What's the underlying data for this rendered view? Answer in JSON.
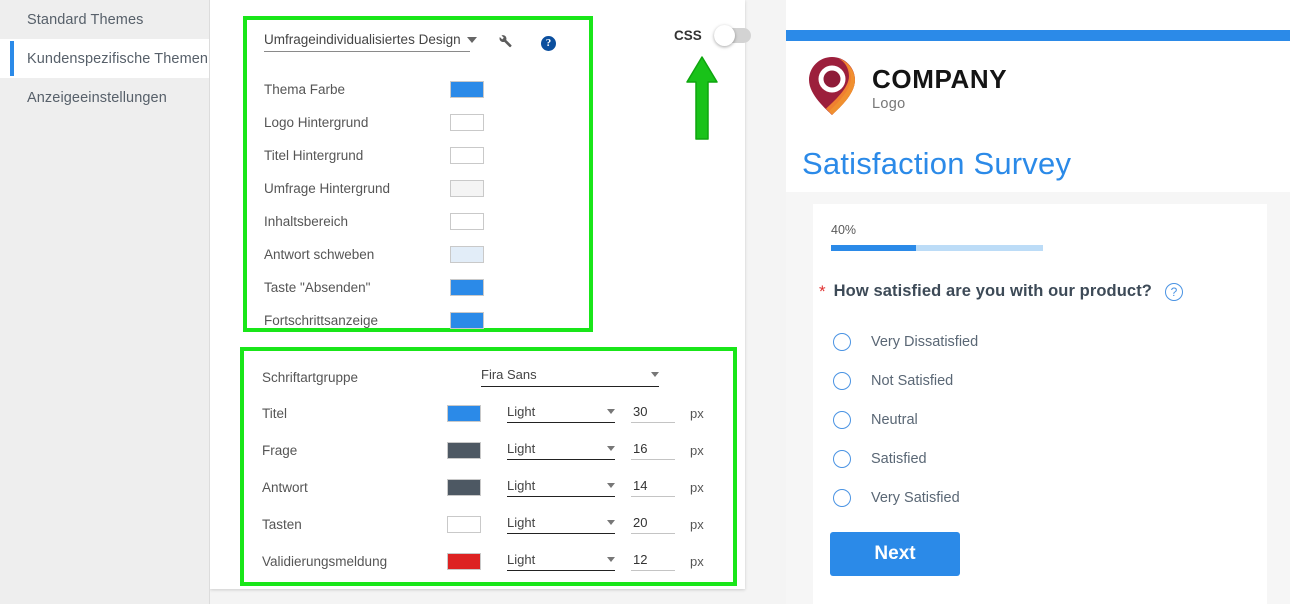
{
  "sidebar": {
    "items": [
      {
        "label": "Standard Themes",
        "active": false
      },
      {
        "label": "Kundenspezifische Themen",
        "active": true
      },
      {
        "label": "Anzeigeeinstellungen",
        "active": false
      }
    ]
  },
  "theme_panel": {
    "selected_theme": "Umfrageindividualisiertes Design",
    "wrench_icon": "wrench-icon",
    "help_icon": "help-icon",
    "help_glyph": "?",
    "color_rows": [
      {
        "label": "Thema Farbe",
        "color": "#2b8ae8"
      },
      {
        "label": "Logo Hintergrund",
        "color": "#ffffff"
      },
      {
        "label": "Titel Hintergrund",
        "color": "#ffffff"
      },
      {
        "label": "Umfrage Hintergrund",
        "color": "#f4f4f4"
      },
      {
        "label": "Inhaltsbereich",
        "color": "#ffffff"
      },
      {
        "label": "Antwort schweben",
        "color": "#e2edf8"
      },
      {
        "label": "Taste \"Absenden\"",
        "color": "#2b8ae8"
      },
      {
        "label": "Fortschrittsanzeige",
        "color": "#2b8ae8"
      }
    ]
  },
  "font_panel": {
    "group_label": "Schriftartgruppe",
    "group_value": "Fira Sans",
    "unit": "px",
    "rows": [
      {
        "label": "Titel",
        "color": "#2b8ae8",
        "weight": "Light",
        "size": "30"
      },
      {
        "label": "Frage",
        "color": "#4d5863",
        "weight": "Light",
        "size": "16"
      },
      {
        "label": "Antwort",
        "color": "#4d5863",
        "weight": "Light",
        "size": "14"
      },
      {
        "label": "Tasten",
        "color": "#ffffff",
        "weight": "Light",
        "size": "20"
      },
      {
        "label": "Validierungsmeldung",
        "color": "#dd2222",
        "weight": "Light",
        "size": "12"
      }
    ]
  },
  "css_toggle": {
    "label": "CSS",
    "enabled": false,
    "arrow_icon": "green-up-arrow-icon",
    "arrow_color": "#19c219"
  },
  "preview": {
    "topbar_color": "#2b8ae8",
    "logo": {
      "icon": "map-pin-logo-icon",
      "company": "COMPANY",
      "sub": "Logo"
    },
    "title": "Satisfaction Survey",
    "progress": {
      "percent_label": "40%",
      "percent": 40
    },
    "question": {
      "required_marker": "*",
      "text": "How satisfied are you with our product?",
      "help_icon": "question-help-icon",
      "help_glyph": "?"
    },
    "options": [
      "Very Dissatisfied",
      "Not Satisfied",
      "Neutral",
      "Satisfied",
      "Very Satisfied"
    ],
    "next_label": "Next"
  }
}
